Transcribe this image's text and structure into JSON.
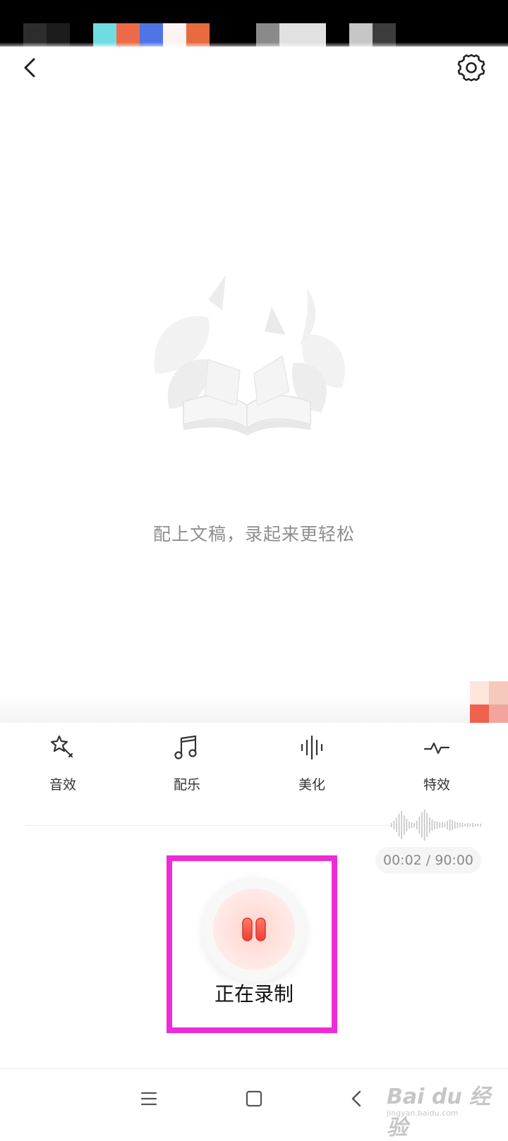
{
  "status_bar": {
    "pixel_colors": [
      "#2d2d2d",
      "#1c1c1c",
      "#6fdde0",
      "#ec6a47",
      "#4f74e8",
      "#fdf3f3",
      "#e86b3f",
      "#000000",
      "#8a8a8a",
      "#e1e1e1",
      "#e1e1e1",
      "#000000",
      "#c6c6c6",
      "#3c3c3c"
    ]
  },
  "header": {
    "back_icon": "chevron-left-icon",
    "settings_icon": "gear-icon"
  },
  "empty_state": {
    "illustration": "open-book-illustration",
    "text": "配上文稿，录起来更轻松"
  },
  "tools": [
    {
      "label": "音效",
      "icon": "magic-wand-icon"
    },
    {
      "label": "配乐",
      "icon": "music-note-icon"
    },
    {
      "label": "美化",
      "icon": "sound-bars-icon"
    },
    {
      "label": "特效",
      "icon": "pulse-wave-icon"
    }
  ],
  "recording": {
    "time_display": "00:02 / 90:00",
    "status_label": "正在录制",
    "button_icon": "pause-icon",
    "accent_color": "#f2554a",
    "highlight_color": "#ee2bd6"
  },
  "nav": {
    "menu_icon": "menu-icon",
    "home_icon": "home-square-icon",
    "back_icon": "back-triangle-icon"
  },
  "watermark": {
    "text": "Bai du 经验",
    "url": "jingyan.baidu.com"
  }
}
